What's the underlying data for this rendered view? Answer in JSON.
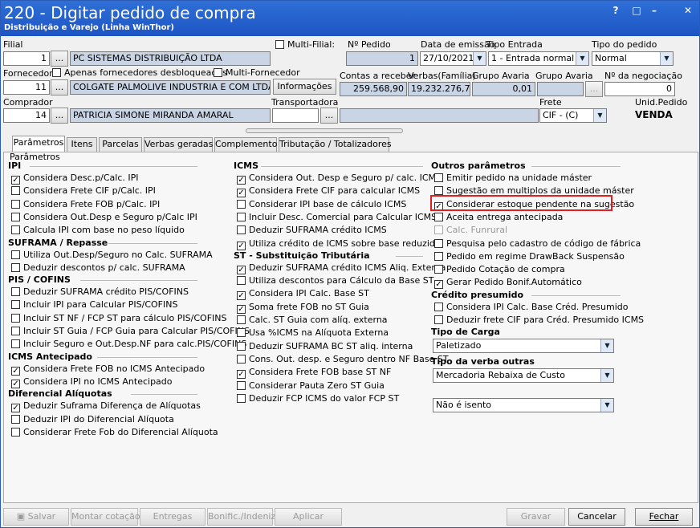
{
  "window": {
    "title": "220 - Digitar pedido de compra",
    "subtitle": "Distribuição e Varejo (Linha WinThor)",
    "controls": [
      "?",
      "□",
      "–",
      "✕"
    ]
  },
  "header": {
    "filial_label": "Filial",
    "filial_code": "1",
    "filial_name": "PC SISTEMAS DISTRIBUIÇÃO LTDA",
    "multi_filial_label": "Multi-Filial:",
    "num_pedido_label": "Nº Pedido",
    "num_pedido": "1",
    "data_emissao_label": "Data de emissão",
    "data_emissao": "27/10/2021",
    "tipo_entrada_label": "Tipo Entrada",
    "tipo_entrada": "1 - Entrada normal",
    "tipo_pedido_label": "Tipo do pedido",
    "tipo_pedido": "Normal",
    "fornecedor_label": "Fornecedor",
    "apenas_label": "Apenas fornecedores desbloqueados",
    "multi_fornecedor_label": "Multi-Fornecedor",
    "fornecedor_code": "11",
    "fornecedor_name": "COLGATE PALMOLIVE INDUSTRIA  E COM LTDA",
    "informacoes_label": "Informações",
    "contas_label": "Contas a receber",
    "contas_value": "259.568,90",
    "verbas_label": "Verbas(Família)",
    "verbas_value": "19.232.276,75",
    "grupo_avaria_label1": "Grupo Avaria",
    "grupo_avaria_value": "0,01",
    "grupo_avaria_label2": "Grupo Avaria",
    "negociacao_label": "Nº da negociação",
    "negociacao_value": "0",
    "comprador_label": "Comprador",
    "comprador_code": "14",
    "comprador_name": "PATRICIA SIMONE MIRANDA AMARAL",
    "transportadora_label": "Transportadora",
    "frete_label": "Frete",
    "frete_value": "CIF - (C)",
    "unid_pedido_label": "Unid.Pedido",
    "unid_pedido_value": "VENDA",
    "ellipsis": "..."
  },
  "tabs": [
    "Parâmetros",
    "Itens",
    "Parcelas",
    "Verbas geradas",
    "Complemento",
    "Tributação / Totalizadores"
  ],
  "panel": {
    "group_label": "Parâmetros",
    "col1": [
      {
        "type": "section",
        "label": "IPI"
      },
      {
        "type": "cb",
        "label": "Considera Desc.p/Calc. IPI",
        "checked": true
      },
      {
        "type": "cb",
        "label": "Considera Frete CIF p/Calc. IPI",
        "checked": false
      },
      {
        "type": "cb",
        "label": "Considera Frete FOB p/Calc. IPI",
        "checked": false
      },
      {
        "type": "cb",
        "label": "Considera Out.Desp e Seguro p/Calc IPI",
        "checked": false
      },
      {
        "type": "cb",
        "label": "Calcula IPI com base no peso líquido",
        "checked": false
      },
      {
        "type": "section",
        "label": "SUFRAMA / Repasse"
      },
      {
        "type": "cb",
        "label": "Utiliza Out.Desp/Seguro no Calc. SUFRAMA",
        "checked": false
      },
      {
        "type": "cb",
        "label": "Deduzir descontos p/ calc. SUFRAMA",
        "checked": false
      },
      {
        "type": "section",
        "label": "PIS / COFINS"
      },
      {
        "type": "cb",
        "label": "Deduzir SUFRAMA crédito PIS/COFINS",
        "checked": false
      },
      {
        "type": "cb",
        "label": "Incluir IPI para Calcular PIS/COFINS",
        "checked": false
      },
      {
        "type": "cb",
        "label": "Incluir ST NF / FCP ST para cálculo PIS/COFINS",
        "checked": false
      },
      {
        "type": "cb",
        "label": "Incluir ST Guia / FCP Guia para Calcular PIS/COFINS",
        "checked": false
      },
      {
        "type": "cb",
        "label": "Incluir Seguro e Out.Desp.NF para calc.PIS/COFINS",
        "checked": false
      },
      {
        "type": "section",
        "label": "ICMS Antecipado"
      },
      {
        "type": "cb",
        "label": "Considera Frete FOB no ICMS Antecipado",
        "checked": true
      },
      {
        "type": "cb",
        "label": "Considera IPI no ICMS Antecipado",
        "checked": true
      },
      {
        "type": "section",
        "label": "Diferencial Alíquotas"
      },
      {
        "type": "cb",
        "label": "Deduzir Suframa Diferença de Alíquotas",
        "checked": true
      },
      {
        "type": "cb",
        "label": "Deduzir IPI do Diferencial Alíquota",
        "checked": false
      },
      {
        "type": "cb",
        "label": "Considerar Frete Fob do Diferencial Alíquota",
        "checked": false
      }
    ],
    "col2": [
      {
        "type": "section",
        "label": "ICMS"
      },
      {
        "type": "cb",
        "label": "Considera Out. Desp e Seguro p/ calc. ICMS",
        "checked": true
      },
      {
        "type": "cb",
        "label": "Considera Frete CIF para calcular ICMS",
        "checked": true
      },
      {
        "type": "cb",
        "label": "Considerar IPI base de cálculo ICMS",
        "checked": false
      },
      {
        "type": "cb",
        "label": "Incluir Desc. Comercial  para Calcular ICMS",
        "checked": false
      },
      {
        "type": "cb",
        "label": "Deduzir SUFRAMA crédito ICMS",
        "checked": false
      },
      {
        "type": "cb",
        "label": "Utiliza crédito de ICMS sobre base reduzida",
        "checked": true
      },
      {
        "type": "section",
        "label": "ST - Substituição Tributária"
      },
      {
        "type": "cb",
        "label": "Deduzir SUFRAMA crédito ICMS Aliq. Externa",
        "checked": true
      },
      {
        "type": "cb",
        "label": "Utiliza descontos para Cálculo da Base ST",
        "checked": false
      },
      {
        "type": "cb",
        "label": "Considera IPI Calc. Base ST",
        "checked": true
      },
      {
        "type": "cb",
        "label": "Soma frete FOB no ST Guia",
        "checked": true
      },
      {
        "type": "cb",
        "label": "Calc. ST Guia com alíq. externa",
        "checked": false
      },
      {
        "type": "cb",
        "label": "Usa %ICMS na Alíquota Externa",
        "checked": false
      },
      {
        "type": "cb",
        "label": "Deduzir SUFRAMA BC ST aliq. interna",
        "checked": false
      },
      {
        "type": "cb",
        "label": "Cons. Out. desp. e Seguro dentro NF Base ST",
        "checked": false
      },
      {
        "type": "cb",
        "label": "Considera Frete FOB base ST NF",
        "checked": true
      },
      {
        "type": "cb",
        "label": "Considerar Pauta Zero ST Guia",
        "checked": false
      },
      {
        "type": "cb",
        "label": "Deduzir FCP ICMS do valor FCP ST",
        "checked": false
      }
    ],
    "col3": [
      {
        "type": "section",
        "label": "Outros parâmetros"
      },
      {
        "type": "cb",
        "label": "Emitir pedido na unidade máster",
        "checked": false
      },
      {
        "type": "cb",
        "label": "Sugestão em multiplos da unidade máster",
        "checked": false
      },
      {
        "type": "cb",
        "label": "Considerar estoque pendente na sugestão",
        "checked": true
      },
      {
        "type": "cb",
        "label": "Aceita entrega antecipada",
        "checked": false
      },
      {
        "type": "cb",
        "label": "Calc. Funrural",
        "checked": false,
        "disabled": true
      },
      {
        "type": "cb",
        "label": "Pesquisa pelo cadastro de código de fábrica",
        "checked": false
      },
      {
        "type": "cb",
        "label": "Pedido em regime DrawBack Suspensão",
        "checked": false
      },
      {
        "type": "cb",
        "label": "Pedido Cotação de compra",
        "checked": false
      },
      {
        "type": "cb",
        "label": "Gerar Pedido Bonif.Automático",
        "checked": true
      },
      {
        "type": "section",
        "label": "Crédito presumido"
      },
      {
        "type": "cb",
        "label": "Considera IPI Calc. Base Créd. Presumido",
        "checked": false
      },
      {
        "type": "cb",
        "label": "Deduzir frete CIF para Créd. Presumido ICMS",
        "checked": false
      }
    ],
    "tipo_carga_label": "Tipo de Carga",
    "tipo_carga_value": "Paletizado",
    "tipo_verba_label": "Tipo da verba outras",
    "tipo_verba_value": "Mercadoria Rebaixa de Custo",
    "isento_value": "Não é isento"
  },
  "footer": {
    "salvar": "Salvar",
    "montar": "Montar cotação",
    "entregas": "Entregas",
    "bonific": "Bonific./Indeniz.",
    "aplicar": "Aplicar",
    "gravar": "Gravar",
    "cancelar": "Cancelar",
    "fechar": "Fechar"
  }
}
